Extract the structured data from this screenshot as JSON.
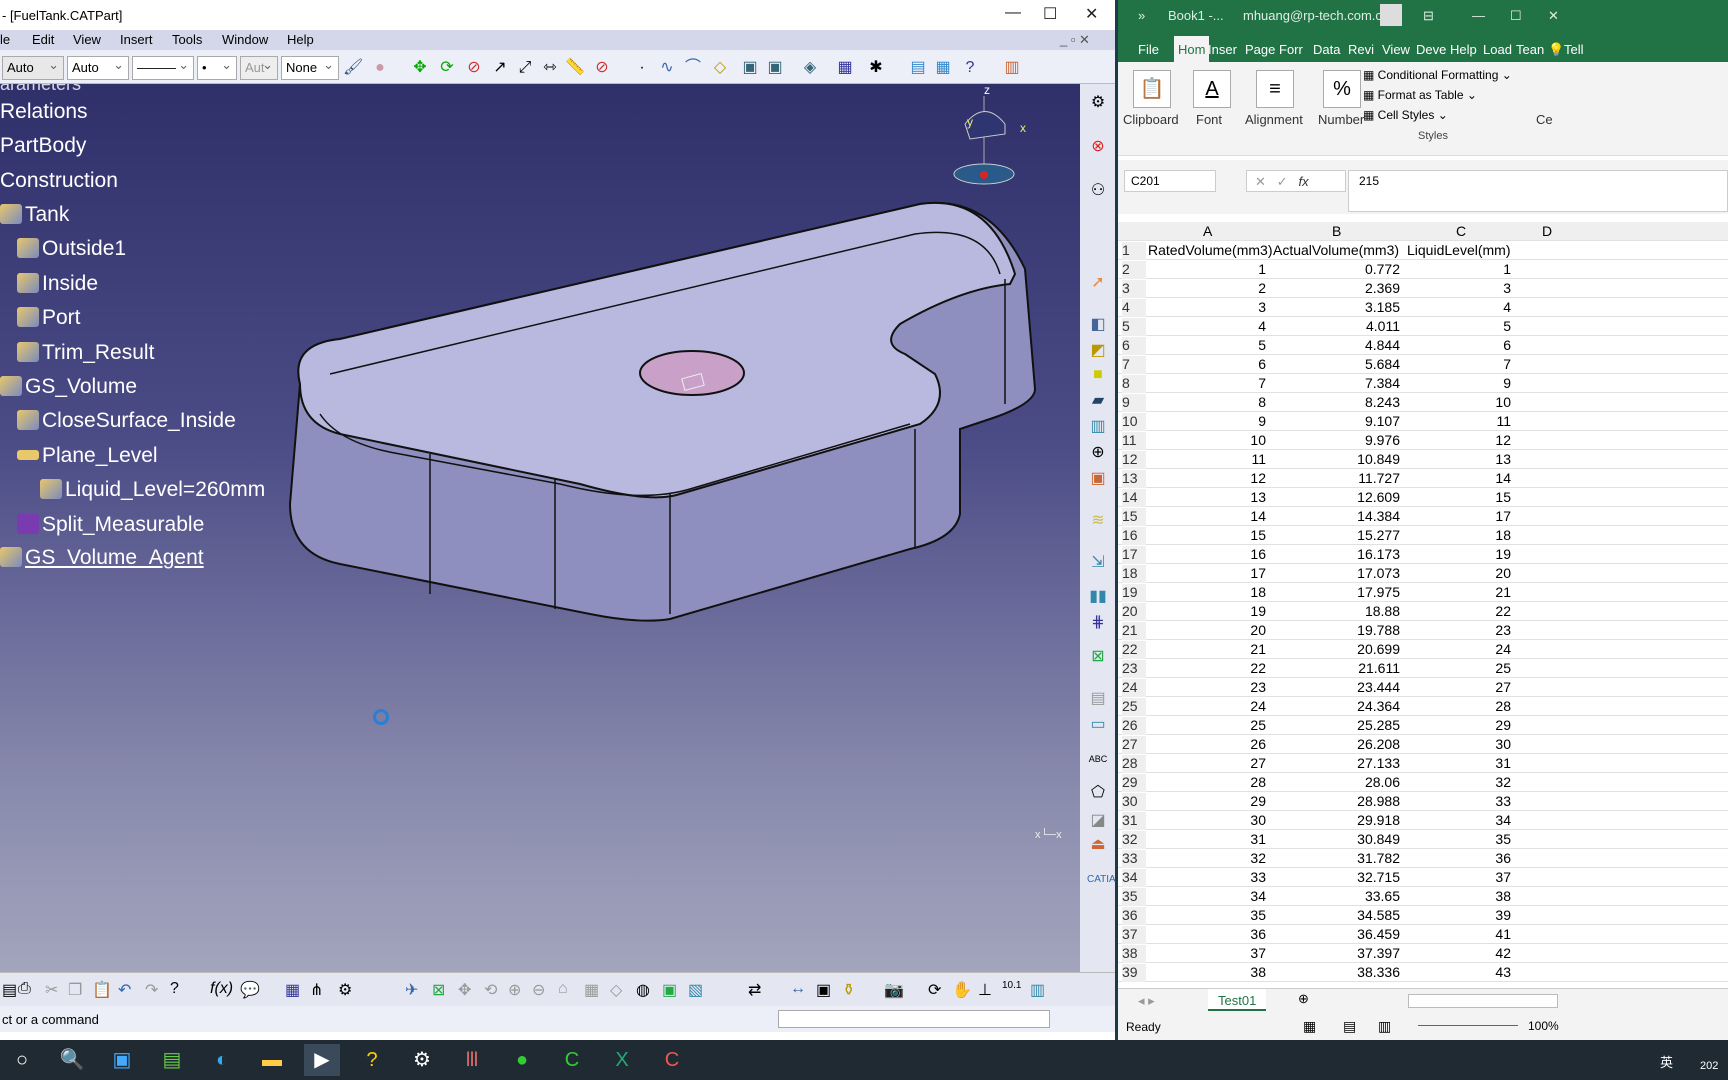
{
  "catia": {
    "title": "- [FuelTank.CATPart]",
    "menu": [
      "le",
      "Edit",
      "View",
      "Insert",
      "Tools",
      "Window",
      "Help"
    ],
    "toolbar_selects": [
      "Auto",
      "Auto",
      "———",
      "•",
      "Aut",
      "None"
    ],
    "tree": [
      {
        "label": "Relations"
      },
      {
        "label": "PartBody"
      },
      {
        "label": "Construction"
      },
      {
        "label": "Tank"
      },
      {
        "label": "Outside1"
      },
      {
        "label": "Inside"
      },
      {
        "label": "Port"
      },
      {
        "label": "Trim_Result"
      },
      {
        "label": "GS_Volume"
      },
      {
        "label": "CloseSurface_Inside"
      },
      {
        "label": "Plane_Level"
      },
      {
        "label": "Liquid_Level=260mm"
      },
      {
        "label": "Split_Measurable"
      },
      {
        "label": "GS_Volume_Agent"
      }
    ],
    "compass_axes": [
      "z",
      "y",
      "x"
    ],
    "status": "ct or a command",
    "model_color": "#b9b9e0",
    "background_color": "#3b3b78"
  },
  "excel": {
    "title": "Book1 -...",
    "user": "mhuang@rp-tech.com.cn",
    "tabs": [
      "File",
      "Hom",
      "Inser",
      "Page",
      "Forr",
      "Data",
      "Revi",
      "View",
      "Deve",
      "Help",
      "Load",
      "Tean",
      "Tell"
    ],
    "ribbon": {
      "clipboard": "Clipboard",
      "font": "Font",
      "alignment": "Alignment",
      "number": "Number",
      "cond_format": "Conditional Formatting",
      "format_table": "Format as Table",
      "cell_styles": "Cell Styles",
      "styles": "Styles",
      "cells": "Ce"
    },
    "name_box": "C201",
    "formula": "215",
    "columns": [
      "A",
      "B",
      "C",
      "D"
    ],
    "headers": [
      "RatedVolume(mm3)",
      "ActualVolume(mm3)",
      "LiquidLevel(mm)"
    ],
    "rated": [
      1,
      2,
      3,
      4,
      5,
      6,
      7,
      8,
      9,
      10,
      11,
      12,
      13,
      14,
      15,
      16,
      17,
      18,
      19,
      20,
      21,
      22,
      23,
      24,
      25,
      26,
      27,
      28,
      29,
      30,
      31,
      32,
      33,
      34,
      35,
      36,
      37,
      38
    ],
    "actual": [
      "0.772",
      "2.369",
      "3.185",
      "4.011",
      "4.844",
      "5.684",
      "7.384",
      "8.243",
      "9.107",
      "9.976",
      "10.849",
      "11.727",
      "12.609",
      "14.384",
      "15.277",
      "16.173",
      "17.073",
      "17.975",
      "18.88",
      "19.788",
      "20.699",
      "21.611",
      "23.444",
      "24.364",
      "25.285",
      "26.208",
      "27.133",
      "28.06",
      "28.988",
      "29.918",
      "30.849",
      "31.782",
      "32.715",
      "33.65",
      "34.585",
      "36.459",
      "37.397",
      "38.336"
    ],
    "level": [
      1,
      3,
      4,
      5,
      6,
      7,
      9,
      10,
      11,
      12,
      13,
      14,
      15,
      17,
      18,
      19,
      20,
      21,
      22,
      23,
      24,
      25,
      27,
      28,
      29,
      30,
      31,
      32,
      33,
      34,
      35,
      36,
      37,
      38,
      39,
      41,
      42,
      43
    ],
    "sheet_tab": "Test01",
    "status": "Ready",
    "zoom": "100%",
    "accent": "#217346"
  },
  "taskbar": {
    "ime": "英",
    "clock_partial": "202"
  }
}
